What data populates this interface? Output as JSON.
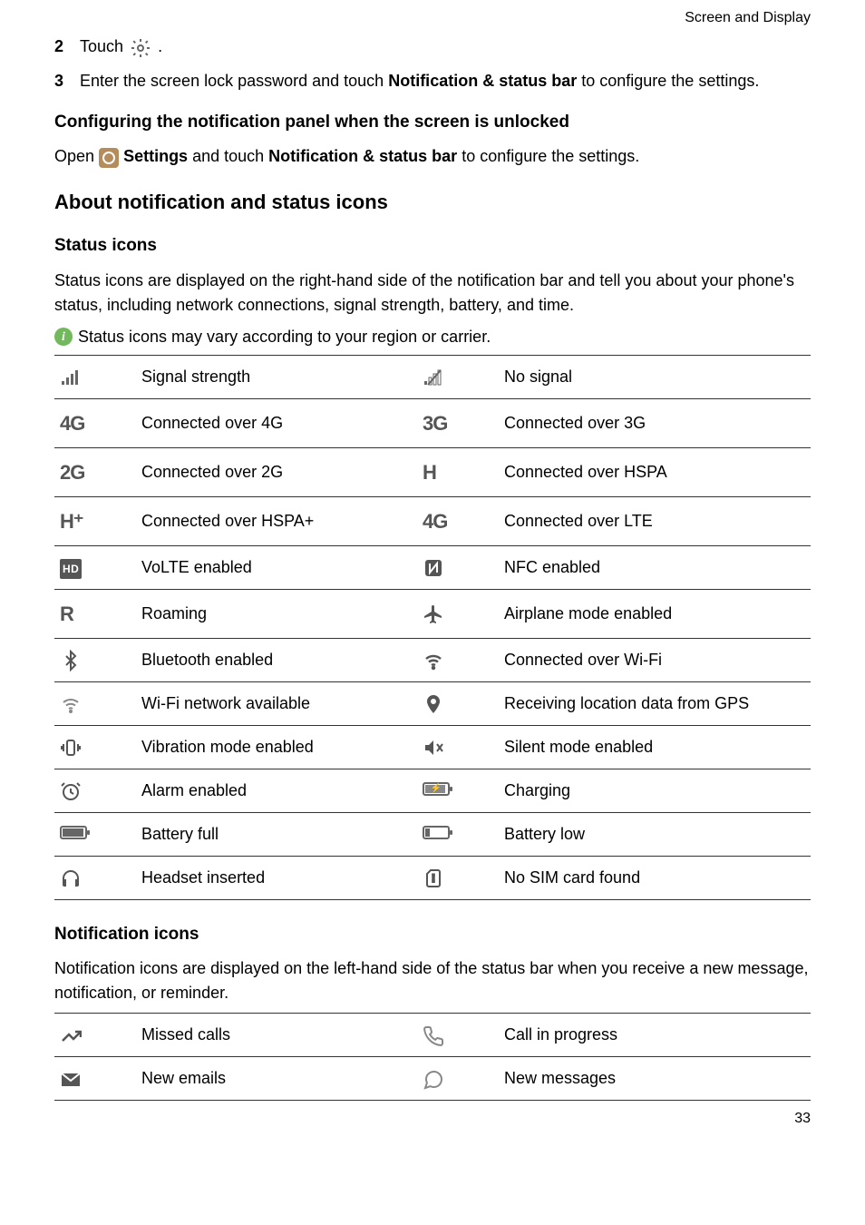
{
  "header": {
    "section": "Screen and Display"
  },
  "steps": {
    "s2": {
      "num": "2",
      "text_a": "Touch ",
      "text_b": " ."
    },
    "s3": {
      "num": "3",
      "text_a": "Enter the screen lock password and touch ",
      "bold": "Notification & status bar",
      "text_b": " to configure the settings."
    }
  },
  "config_heading": "Configuring the notification panel when the screen is unlocked",
  "config_text": {
    "a": "Open ",
    "b": " Settings",
    "c": " and touch ",
    "d": "Notification & status bar",
    "e": " to configure the settings."
  },
  "about_heading": "About notification and status icons",
  "status_heading": "Status icons",
  "status_para": "Status icons are displayed on the right-hand side of the notification bar and tell you about your phone's status, including network connections, signal strength, battery, and time.",
  "status_note": "Status icons may vary according to your region or carrier.",
  "status_table": [
    {
      "l": "Signal strength",
      "r": "No signal",
      "li": "signal-bars-icon",
      "ri": "no-signal-icon"
    },
    {
      "l": "Connected over 4G",
      "r": "Connected over 3G",
      "li": "4g-icon",
      "ri": "3g-icon",
      "lt": "4G",
      "rt": "3G"
    },
    {
      "l": "Connected over 2G",
      "r": "Connected over HSPA",
      "li": "2g-icon",
      "ri": "h-icon",
      "lt": "2G",
      "rt": "H"
    },
    {
      "l": "Connected over HSPA+",
      "r": "Connected over LTE",
      "li": "hplus-icon",
      "ri": "4g-lte-icon",
      "lt": "H⁺",
      "rt": "4G"
    },
    {
      "l": "VoLTE enabled",
      "r": "NFC enabled",
      "li": "hd-icon",
      "ri": "nfc-icon"
    },
    {
      "l": "Roaming",
      "r": "Airplane mode enabled",
      "li": "roaming-icon",
      "ri": "airplane-icon",
      "lt": "R"
    },
    {
      "l": "Bluetooth enabled",
      "r": "Connected over Wi-Fi",
      "li": "bluetooth-icon",
      "ri": "wifi-icon"
    },
    {
      "l": "Wi-Fi network available",
      "r": "Receiving location data from GPS",
      "li": "wifi-available-icon",
      "ri": "location-icon"
    },
    {
      "l": "Vibration mode enabled",
      "r": "Silent mode enabled",
      "li": "vibration-icon",
      "ri": "silent-icon"
    },
    {
      "l": "Alarm enabled",
      "r": "Charging",
      "li": "alarm-icon",
      "ri": "charging-icon"
    },
    {
      "l": "Battery full",
      "r": "Battery low",
      "li": "battery-full-icon",
      "ri": "battery-low-icon"
    },
    {
      "l": "Headset inserted",
      "r": "No SIM card found",
      "li": "headset-icon",
      "ri": "no-sim-icon"
    }
  ],
  "notif_heading": "Notification icons",
  "notif_para": "Notification icons are displayed on the left-hand side of the status bar when you receive a new message, notification, or reminder.",
  "notif_table": [
    {
      "l": "Missed calls",
      "r": "Call in progress",
      "li": "missed-call-icon",
      "ri": "call-icon"
    },
    {
      "l": "New emails",
      "r": "New messages",
      "li": "email-icon",
      "ri": "message-icon"
    }
  ],
  "page_num": "33"
}
